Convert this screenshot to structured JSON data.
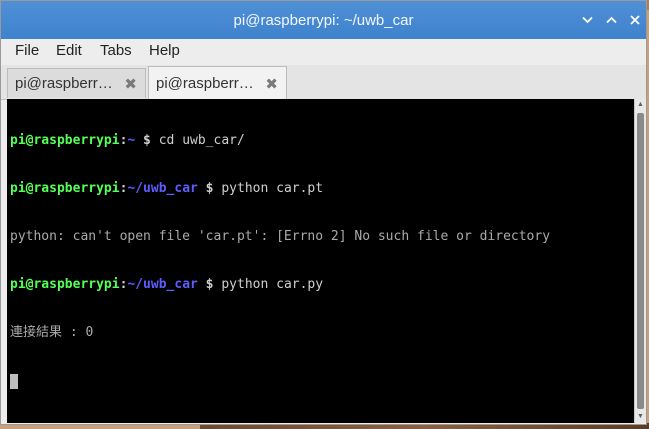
{
  "window": {
    "title": "pi@raspberrypi: ~/uwb_car",
    "controls": {
      "minimize": "chevron-down",
      "maximize": "chevron-up",
      "close": "close-x"
    }
  },
  "menubar": {
    "items": [
      "File",
      "Edit",
      "Tabs",
      "Help"
    ]
  },
  "tabs": [
    {
      "label": "pi@raspberr…",
      "active": false
    },
    {
      "label": "pi@raspberr…",
      "active": true
    }
  ],
  "tab_close_glyph": "✖",
  "terminal": {
    "lines": [
      {
        "user": "pi@raspberrypi",
        "sep": ":",
        "path": "~",
        "prompt": " $ ",
        "command": "cd uwb_car/"
      },
      {
        "user": "pi@raspberrypi",
        "sep": ":",
        "path": "~/uwb_car",
        "prompt": " $ ",
        "command": "python car.pt"
      },
      {
        "output": "python: can't open file 'car.pt': [Errno 2] No such file or directory"
      },
      {
        "user": "pi@raspberrypi",
        "sep": ":",
        "path": "~/uwb_car",
        "prompt": " $ ",
        "command": "python car.py"
      },
      {
        "output": "連接結果 : 0"
      }
    ]
  },
  "colors": {
    "titlebar": "#4a8bd2",
    "terminal_bg": "#000000",
    "prompt_user": "#55ff55",
    "prompt_path": "#5c5cff"
  }
}
